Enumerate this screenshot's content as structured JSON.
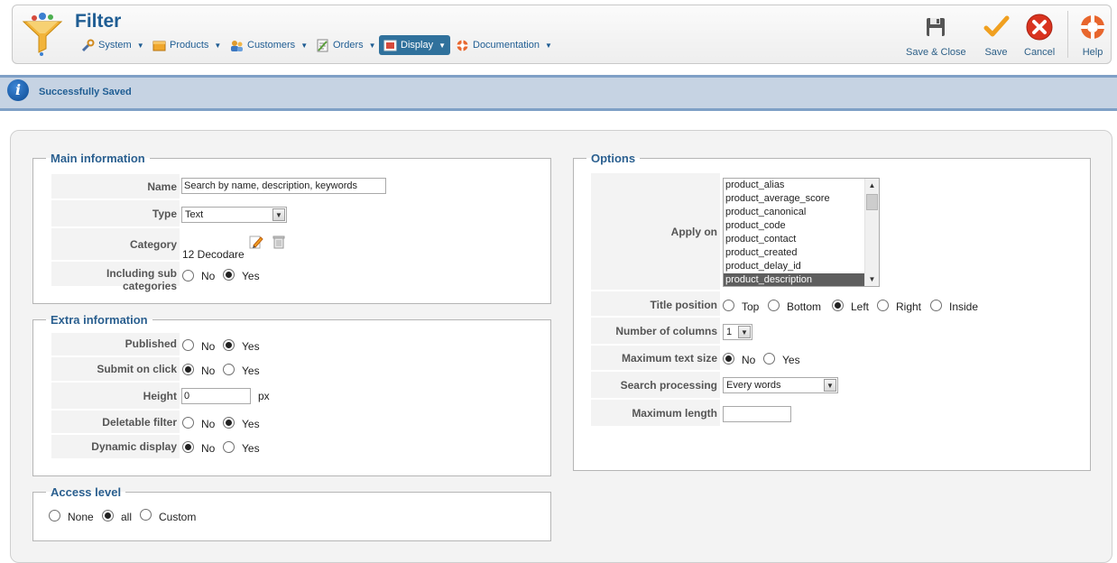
{
  "app": {
    "title": "Filter"
  },
  "menu": [
    {
      "label": "System",
      "icon": "tools-icon"
    },
    {
      "label": "Products",
      "icon": "products-icon"
    },
    {
      "label": "Customers",
      "icon": "customers-icon"
    },
    {
      "label": "Orders",
      "icon": "orders-icon"
    },
    {
      "label": "Display",
      "icon": "display-icon",
      "active": true
    },
    {
      "label": "Documentation",
      "icon": "lifebuoy-icon"
    }
  ],
  "toolbar": {
    "save_close": "Save & Close",
    "save": "Save",
    "cancel": "Cancel",
    "help": "Help"
  },
  "message": {
    "text": "Successfully Saved",
    "icon": "info-icon"
  },
  "main_information": {
    "legend": "Main information",
    "name_label": "Name",
    "name_value": "Search by name, description, keywords",
    "type_label": "Type",
    "type_value": "Text",
    "category_label": "Category",
    "category_value": "12 Decodare",
    "subcat_label": "Including sub categories",
    "no": "No",
    "yes": "Yes",
    "subcat_selected": "Yes"
  },
  "extra_information": {
    "legend": "Extra information",
    "published_label": "Published",
    "published_selected": "Yes",
    "submit_label": "Submit on click",
    "submit_selected": "No",
    "height_label": "Height",
    "height_value": "0",
    "height_unit": "px",
    "deletable_label": "Deletable filter",
    "deletable_selected": "Yes",
    "dynamic_label": "Dynamic display",
    "dynamic_selected": "No",
    "no": "No",
    "yes": "Yes"
  },
  "access_level": {
    "legend": "Access level",
    "none": "None",
    "all": "all",
    "custom": "Custom",
    "selected": "all"
  },
  "options": {
    "legend": "Options",
    "apply_label": "Apply on",
    "apply_items": [
      "product_alias",
      "product_average_score",
      "product_canonical",
      "product_code",
      "product_contact",
      "product_created",
      "product_delay_id",
      "product_description"
    ],
    "apply_selected": "product_description",
    "title_position_label": "Title position",
    "pos_top": "Top",
    "pos_bottom": "Bottom",
    "pos_left": "Left",
    "pos_right": "Right",
    "pos_inside": "Inside",
    "title_position_selected": "Left",
    "columns_label": "Number of columns",
    "columns_value": "1",
    "max_text_label": "Maximum text size",
    "max_text_selected": "No",
    "no": "No",
    "yes": "Yes",
    "search_processing_label": "Search processing",
    "search_processing_value": "Every words",
    "max_length_label": "Maximum length",
    "max_length_value": ""
  }
}
